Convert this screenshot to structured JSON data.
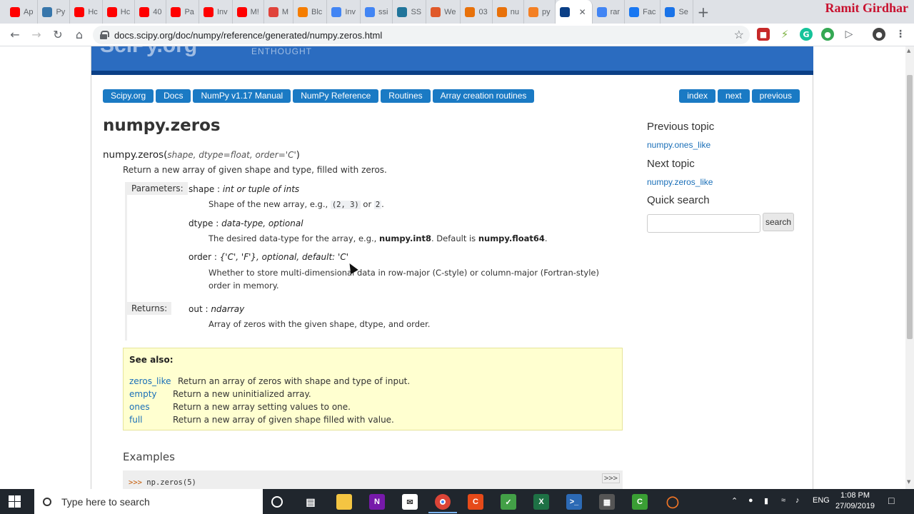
{
  "browser": {
    "tabs": [
      {
        "label": "Ap",
        "color": "#ff0000"
      },
      {
        "label": "Py",
        "color": "#3776ab"
      },
      {
        "label": "Hc",
        "color": "#ff0000"
      },
      {
        "label": "Hc",
        "color": "#ff0000"
      },
      {
        "label": "40",
        "color": "#ff0000"
      },
      {
        "label": "Pa",
        "color": "#ff0000"
      },
      {
        "label": "Inv",
        "color": "#ff0000"
      },
      {
        "label": "M!",
        "color": "#ff0000"
      },
      {
        "label": "M",
        "color": "#e0433b"
      },
      {
        "label": "Blc",
        "color": "#f57d00"
      },
      {
        "label": "Inv",
        "color": "#4285f4"
      },
      {
        "label": "ssi",
        "color": "#4285f4"
      },
      {
        "label": "SS",
        "color": "#21759b"
      },
      {
        "label": "We",
        "color": "#e0592a"
      },
      {
        "label": "03",
        "color": "#e8710a"
      },
      {
        "label": "nu",
        "color": "#e8710a"
      },
      {
        "label": "py",
        "color": "#f48024"
      }
    ],
    "active_tab": {
      "label": "",
      "color": "#0b3f86"
    },
    "tabs_after": [
      {
        "label": "rar",
        "color": "#4285f4"
      },
      {
        "label": "Fac",
        "color": "#1877f2"
      },
      {
        "label": "Se",
        "color": "#1a73e8"
      }
    ],
    "new_tab": "+",
    "author": "Ramit Girdhar",
    "url": "docs.scipy.org/doc/numpy/reference/generated/numpy.zeros.html"
  },
  "site": {
    "logo": "SciPy.org",
    "logo2": "ENTHOUGHT",
    "breadcrumbs": [
      "Scipy.org",
      "Docs",
      "NumPy v1.17 Manual",
      "NumPy Reference",
      "Routines",
      "Array creation routines"
    ],
    "rel_links": [
      "index",
      "next",
      "previous"
    ]
  },
  "doc": {
    "title": "numpy.zeros",
    "signature": {
      "name": "numpy.zeros(",
      "args": "shape, dtype=float, order='C'",
      "close": ")"
    },
    "description": "Return a new array of given shape and type, filled with zeros.",
    "parameters_label": "Parameters:",
    "params": [
      {
        "name": "shape : ",
        "type": "int or tuple of ints",
        "desc_pre": "Shape of the new array, e.g., ",
        "code1": "(2, 3)",
        "mid": " or ",
        "code2": "2",
        "post": "."
      },
      {
        "name": "dtype : ",
        "type": "data-type, optional",
        "desc_pre": "The desired data-type for the array, e.g., ",
        "b1": "numpy.int8",
        "mid": ". Default is ",
        "b2": "numpy.float64",
        "post": "."
      },
      {
        "name": "order : ",
        "type": "{'C', 'F'}, optional, default: 'C'",
        "desc_line1": "Whether to store multi-dimensional data in row-major (C-style) or column-major (Fortran-style)",
        "desc_line2": "order in memory."
      }
    ],
    "returns_label": "Returns:",
    "returns": {
      "name": "out : ",
      "type": "ndarray",
      "desc": "Array of zeros with the given shape, dtype, and order."
    },
    "see_also": {
      "title": "See also:",
      "items": [
        {
          "link": "zeros_like",
          "text": "Return an array of zeros with shape and type of input."
        },
        {
          "link": "empty",
          "text": "Return a new uninitialized array."
        },
        {
          "link": "ones",
          "text": "Return a new array setting values to one."
        },
        {
          "link": "full",
          "text": "Return a new array of given shape filled with value."
        }
      ]
    },
    "examples_heading": "Examples",
    "example_prompt": ">>>",
    "example_code": "np.zeros(5)",
    "example_toggle": ">>>"
  },
  "sidebar": {
    "prev_heading": "Previous topic",
    "prev_link": "numpy.ones_like",
    "next_heading": "Next topic",
    "next_link": "numpy.zeros_like",
    "search_heading": "Quick search",
    "search_button": "search"
  },
  "taskbar": {
    "search_placeholder": "Type here to search",
    "language": "ENG",
    "time": "1:08 PM",
    "date": "27/09/2019"
  }
}
